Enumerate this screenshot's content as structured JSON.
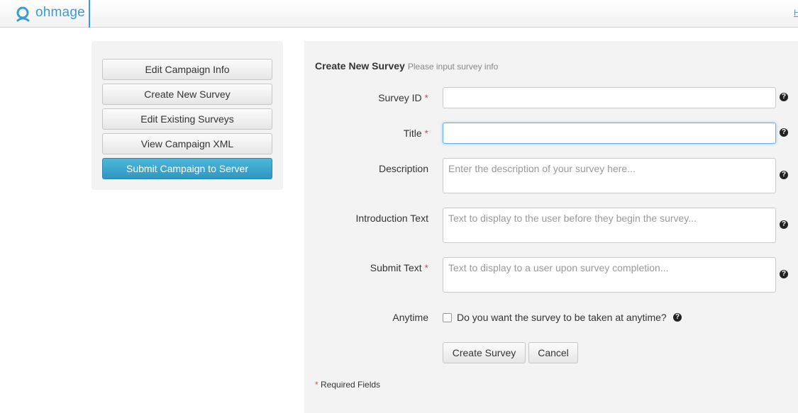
{
  "header": {
    "brand": "ohmage",
    "right_link": "H"
  },
  "sidebar": {
    "items": [
      {
        "label": "Edit Campaign Info"
      },
      {
        "label": "Create New Survey"
      },
      {
        "label": "Edit Existing Surveys"
      },
      {
        "label": "View Campaign XML"
      },
      {
        "label": "Submit Campaign to Server"
      }
    ]
  },
  "form": {
    "title": "Create New Survey",
    "subtitle": "Please input survey info",
    "required_marker": "*",
    "help_glyph": "?",
    "fields": {
      "survey_id": {
        "label": "Survey ID",
        "value": "",
        "placeholder": ""
      },
      "title": {
        "label": "Title",
        "value": "",
        "placeholder": ""
      },
      "description": {
        "label": "Description",
        "placeholder": "Enter the description of your survey here..."
      },
      "intro_text": {
        "label": "Introduction Text",
        "placeholder": "Text to display to the user before they begin the survey..."
      },
      "submit_text": {
        "label": "Submit Text",
        "placeholder": "Text to display to a user upon survey completion..."
      },
      "anytime": {
        "label": "Anytime",
        "checkbox_label": "Do you want the survey to be taken at anytime?",
        "checked": false
      }
    },
    "buttons": {
      "create": "Create Survey",
      "cancel": "Cancel"
    },
    "footnote": "Required Fields"
  },
  "colors": {
    "brand": "#3a9cd0",
    "primary_button": "#3aa6cf",
    "required": "#d9534f"
  },
  "icons": {
    "brand_logo": "ohmage-logo-icon",
    "help": "help-question-icon"
  }
}
